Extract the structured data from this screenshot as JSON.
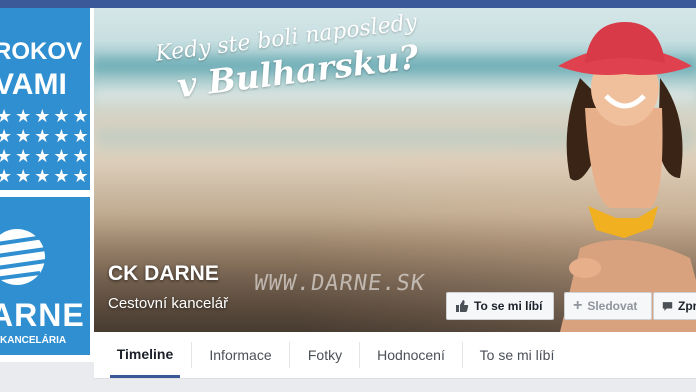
{
  "cover": {
    "tagline_line1": "Kedy ste boli naposledy",
    "tagline_line2": "v Bulharsku?",
    "watermark": "WWW.DARNE.SK"
  },
  "page": {
    "name": "CK DARNE",
    "category": "Cestovní kancelář"
  },
  "profile_picture": {
    "text_line1": "ROKOV",
    "text_line2": "VAMI",
    "stars": "★★★★★",
    "brand": "ARNE",
    "subtitle": "Á KANCELÁRIA"
  },
  "actions": {
    "like_label": "To se mi líbí",
    "follow_label": "Sledovat",
    "message_label": "Zprá"
  },
  "tabs": [
    "Timeline",
    "Informace",
    "Fotky",
    "Hodnocení",
    "To se mi líbí"
  ],
  "colors": {
    "facebook_blue": "#3b5998",
    "brand_blue": "#2f8fd0"
  }
}
